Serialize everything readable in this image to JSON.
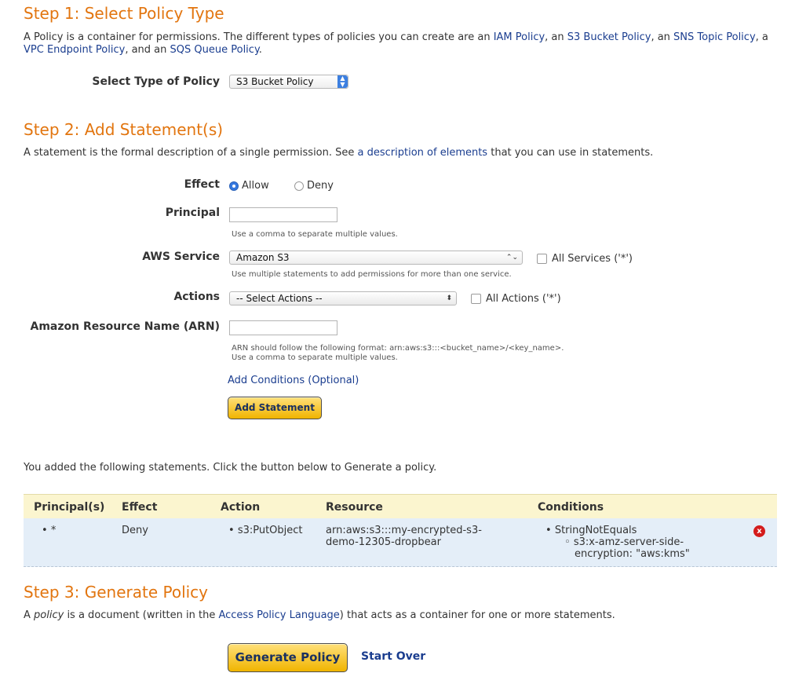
{
  "step1": {
    "title": "Step 1: Select Policy Type",
    "desc": {
      "t1": "A Policy is a container for permissions. The different types of policies you can create are an ",
      "link_iam": "IAM Policy",
      "t2": ", an ",
      "link_s3": "S3 Bucket Policy",
      "t3": ", an ",
      "link_sns": "SNS Topic Policy",
      "t4": ", a ",
      "link_vpc": "VPC Endpoint Policy",
      "t5": ", and an ",
      "link_sqs": "SQS Queue Policy",
      "t6": "."
    },
    "type_label": "Select Type of Policy",
    "type_value": "S3 Bucket Policy"
  },
  "step2": {
    "title": "Step 2: Add Statement(s)",
    "desc": {
      "t1": "A statement is the formal description of a single permission. See ",
      "link": "a description of elements",
      "t2": " that you can use in statements."
    },
    "effect": {
      "label": "Effect",
      "allow": "Allow",
      "deny": "Deny",
      "selected": "Allow"
    },
    "principal": {
      "label": "Principal",
      "value": "",
      "hint": "Use a comma to separate multiple values."
    },
    "aws_service": {
      "label": "AWS Service",
      "value": "Amazon S3",
      "all_label": "All Services ('*')",
      "hint": "Use multiple statements to add permissions for more than one service."
    },
    "actions": {
      "label": "Actions",
      "value": "-- Select Actions --",
      "all_label": "All Actions ('*')"
    },
    "arn": {
      "label": "Amazon Resource Name (ARN)",
      "value": "",
      "hint1": "ARN should follow the following format: arn:aws:s3:::<bucket_name>/<key_name>.",
      "hint2": "Use a comma to separate multiple values."
    },
    "conditions_link": "Add Conditions (Optional)",
    "add_button": "Add Statement"
  },
  "statements": {
    "intro": "You added the following statements. Click the button below to Generate a policy.",
    "headers": [
      "Principal(s)",
      "Effect",
      "Action",
      "Resource",
      "Conditions"
    ],
    "rows": [
      {
        "principal": "*",
        "effect": "Deny",
        "action": "s3:PutObject",
        "resource_l1": "arn:aws:s3:::my-encrypted-s3-",
        "resource_l2": "demo-12305-dropbear",
        "condition": "StringNotEquals",
        "cond_key_l1": "s3:x-amz-server-side-",
        "cond_key_l2": "encryption: \"aws:kms\"",
        "delete_icon": "x"
      }
    ]
  },
  "step3": {
    "title": "Step 3: Generate Policy",
    "desc": {
      "t1": "A ",
      "em": "policy",
      "t2": " is a document (written in the ",
      "link": "Access Policy Language",
      "t3": ") that acts as a container for one or more statements."
    },
    "generate_button": "Generate Policy",
    "start_over": "Start Over"
  },
  "colors": {
    "heading": "#e2750f",
    "link": "#1a3d8f",
    "button": "#f0b400",
    "table_header": "#fbf5cf",
    "table_row": "#e4eef8"
  }
}
